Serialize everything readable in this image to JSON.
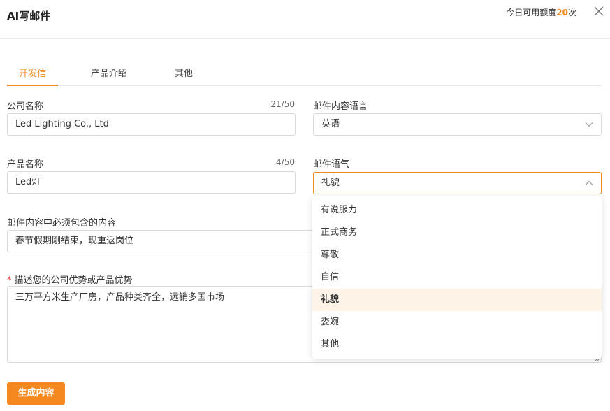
{
  "header": {
    "title": "AI写邮件",
    "quota_prefix": "今日可用额度",
    "quota_count": "20",
    "quota_suffix": "次"
  },
  "tabs": [
    {
      "label": "开发信",
      "active": true
    },
    {
      "label": "产品介绍",
      "active": false
    },
    {
      "label": "其他",
      "active": false
    }
  ],
  "form": {
    "company_name": {
      "label": "公司名称",
      "value": "Led Lighting Co., Ltd",
      "counter": "21/50"
    },
    "email_language": {
      "label": "邮件内容语言",
      "value": "英语"
    },
    "product_name": {
      "label": "产品名称",
      "value": "Led灯",
      "counter": "4/50"
    },
    "email_tone": {
      "label": "邮件语气",
      "value": "礼貌"
    },
    "must_include": {
      "label": "邮件内容中必须包含的内容",
      "value": "春节假期刚结束，现重返岗位"
    },
    "advantages": {
      "required_mark": "*",
      "label": "描述您的公司优势或产品优势",
      "value": "三万平方米生产厂房，产品种类齐全，远销多国市场"
    }
  },
  "tone_options": [
    {
      "label": "有说服力",
      "selected": false
    },
    {
      "label": "正式商务",
      "selected": false
    },
    {
      "label": "尊敬",
      "selected": false
    },
    {
      "label": "自信",
      "selected": false
    },
    {
      "label": "礼貌",
      "selected": true
    },
    {
      "label": "委婉",
      "selected": false
    },
    {
      "label": "其他",
      "selected": false
    }
  ],
  "actions": {
    "generate_label": "生成内容"
  },
  "colors": {
    "accent": "#f18b1b",
    "button": "#f5891f",
    "selected_bg": "#fdf3e6"
  }
}
